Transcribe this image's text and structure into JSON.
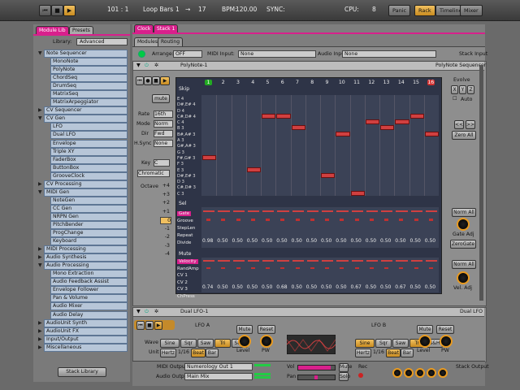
{
  "topbar": {
    "bar_pos": "101 : 1",
    "loop_label": "Loop Bars",
    "loop_start": "1",
    "loop_arrow": "→",
    "loop_end": "17",
    "bpm_label": "BPM:",
    "bpm": "120.00",
    "sync_label": "SYNC:",
    "cpu_label": "CPU:",
    "cpu_value": "8",
    "panic": "Panic",
    "rack": "Rack",
    "timeline": "Timeline",
    "mixer": "Mixer"
  },
  "left": {
    "tab_module_lib": "Module Lib",
    "tab_presets": "Presets",
    "library_label": "Library:",
    "library_value": "Advanced",
    "stack_library": "Stack Library",
    "tree": [
      {
        "label": "Note Sequencer",
        "lvl": 0,
        "open": true
      },
      {
        "label": "MonoNote",
        "lvl": 1
      },
      {
        "label": "PolyNote",
        "lvl": 1
      },
      {
        "label": "ChordSeq",
        "lvl": 1
      },
      {
        "label": "DrumSeq",
        "lvl": 1
      },
      {
        "label": "MatrixSeq",
        "lvl": 1
      },
      {
        "label": "MatrixArpeggiator",
        "lvl": 1
      },
      {
        "label": "CV Sequencer",
        "lvl": 0
      },
      {
        "label": "CV Gen",
        "lvl": 0,
        "open": true
      },
      {
        "label": "LFO",
        "lvl": 1
      },
      {
        "label": "Dual LFO",
        "lvl": 1
      },
      {
        "label": "Envelope",
        "lvl": 1
      },
      {
        "label": "Triple XY",
        "lvl": 1
      },
      {
        "label": "FaderBox",
        "lvl": 1
      },
      {
        "label": "ButtonBox",
        "lvl": 1
      },
      {
        "label": "GrooveClock",
        "lvl": 1
      },
      {
        "label": "CV Processing",
        "lvl": 0
      },
      {
        "label": "MIDI Gen",
        "lvl": 0,
        "open": true
      },
      {
        "label": "NoteGen",
        "lvl": 1
      },
      {
        "label": "CC Gen",
        "lvl": 1
      },
      {
        "label": "NRPN Gen",
        "lvl": 1
      },
      {
        "label": "PitchBender",
        "lvl": 1
      },
      {
        "label": "ProgChange",
        "lvl": 1
      },
      {
        "label": "Keyboard",
        "lvl": 1
      },
      {
        "label": "MIDI Processing",
        "lvl": 0
      },
      {
        "label": "Audio Synthesis",
        "lvl": 0
      },
      {
        "label": "Audio Processing",
        "lvl": 0,
        "open": true
      },
      {
        "label": "Mono Extraction",
        "lvl": 1
      },
      {
        "label": "Audio Feedback Assist",
        "lvl": 1
      },
      {
        "label": "Envelope Follower",
        "lvl": 1
      },
      {
        "label": "Pan & Volume",
        "lvl": 1
      },
      {
        "label": "Audio Mixer",
        "lvl": 1
      },
      {
        "label": "Audio Delay",
        "lvl": 1
      },
      {
        "label": "AudioUnit Synth",
        "lvl": 0
      },
      {
        "label": "AudioUnit FX",
        "lvl": 0
      },
      {
        "label": "Input/Output",
        "lvl": 0
      },
      {
        "label": "Miscellaneous",
        "lvl": 0
      }
    ]
  },
  "main": {
    "tab_clock": "Clock",
    "tab_stack": "Stack 1",
    "sub_modules": "Modules",
    "sub_routing": "Routing",
    "arrange_label": "Arrange:",
    "arrange_value": "OFF",
    "midi_input_label": "MIDI Input:",
    "midi_input_value": "None",
    "audio_input_label": "Audio Input:",
    "audio_input_value": "None",
    "stack_input": "Stack Input"
  },
  "polynote": {
    "title": "PolyNote-1",
    "type": "PolyNote Sequencer",
    "mute": "mute",
    "rate_label": "Rate",
    "rate": "16th",
    "mode_label": "Mode",
    "mode": "Norm",
    "dir_label": "Dir",
    "dir": "Fwd",
    "hsync_label": "H.Sync",
    "hsync": "None",
    "key_label": "Key",
    "key": "C",
    "scale": "Chromatic",
    "octave_label": "Octave",
    "octaves": [
      "+4",
      "+3",
      "+2",
      "+1",
      "0",
      "-1",
      "-2",
      "-3",
      "-4"
    ],
    "skip": "Skip",
    "sel": "Sel",
    "mute_row": "Mute",
    "steps": [
      "1",
      "2",
      "3",
      "4",
      "5",
      "6",
      "7",
      "8",
      "9",
      "10",
      "11",
      "12",
      "13",
      "14",
      "15",
      "16"
    ],
    "notes": [
      "E 4",
      "D#,E# 4",
      "D 4",
      "C#,D# 4",
      "C 4",
      "B 3",
      "B#,A# 3",
      "A 3",
      "G#,A# 3",
      "G 3",
      "F#,G# 3",
      "F 3",
      "E 3",
      "D#,E# 3",
      "D 3",
      "C#,D# 3",
      "C 3"
    ],
    "note_events": [
      [
        1,
        11
      ],
      [
        4,
        13
      ],
      [
        5,
        4
      ],
      [
        6,
        4
      ],
      [
        7,
        6
      ],
      [
        9,
        14
      ],
      [
        10,
        7
      ],
      [
        11,
        17
      ],
      [
        12,
        5
      ],
      [
        13,
        6
      ],
      [
        14,
        5
      ],
      [
        15,
        4
      ],
      [
        16,
        7
      ]
    ],
    "row1": [
      "Gate",
      "Groove",
      "StepLen",
      "Repeat",
      "Divide"
    ],
    "divide_values": [
      "0.98",
      "0.50",
      "0.50",
      "0.50",
      "0.50",
      "0.50",
      "0.50",
      "0.50",
      "0.50",
      "0.50",
      "0.50",
      "0.50",
      "0.50",
      "0.50",
      "0.50",
      "0.50"
    ],
    "row2": [
      "Velocity",
      "RandAmp",
      "CV 1",
      "CV 2",
      "CV 3",
      "ChPress"
    ],
    "cv3_values": [
      "0.74",
      "0.50",
      "0.50",
      "0.50",
      "0.50",
      "0.68",
      "0.50",
      "0.50",
      "0.50",
      "0.50",
      "0.67",
      "0.50",
      "0.50",
      "0.67",
      "0.50",
      "0.50"
    ],
    "evolve": "Evolve",
    "x": "X",
    "y": "Y",
    "z": "Z",
    "auto": "Auto",
    "prev": "<<",
    "next": ">>",
    "zero_all": "Zero All",
    "norm_all1": "Norm All",
    "gate_adj": "Gate Adj",
    "zero_gate": "ZeroGate",
    "norm_all2": "Norm All",
    "vel_adj": "Vel. Adj"
  },
  "duallfo": {
    "title": "Dual LFO-1",
    "type": "Dual LFO",
    "lfo_a": "LFO A",
    "lfo_b": "LFO B",
    "mute": "Mute",
    "reset": "Reset",
    "wave_label": "Wave",
    "waves": [
      "Sine",
      "Sqr",
      "Saw",
      "Tri",
      "S&H"
    ],
    "unit_label": "Unit",
    "hertz": "Hertz",
    "div": "1/16",
    "beat": "Beat",
    "bar": "Bar",
    "level": "Level",
    "pw": "PW"
  },
  "footer": {
    "midi_output_label": "MIDI Output:",
    "midi_output": "Numerology Out 1",
    "audio_output_label": "Audio Output:",
    "audio_output": "Main Mix",
    "vol": "Vol",
    "pan": "Pan",
    "mute": "Mute",
    "solo": "Solo",
    "rec": "Rec",
    "stack_output": "Stack Output"
  },
  "colors": {
    "accent": "#d8208c",
    "orange": "#e89a20",
    "grid": "#3b4256",
    "note": "#d04040"
  }
}
